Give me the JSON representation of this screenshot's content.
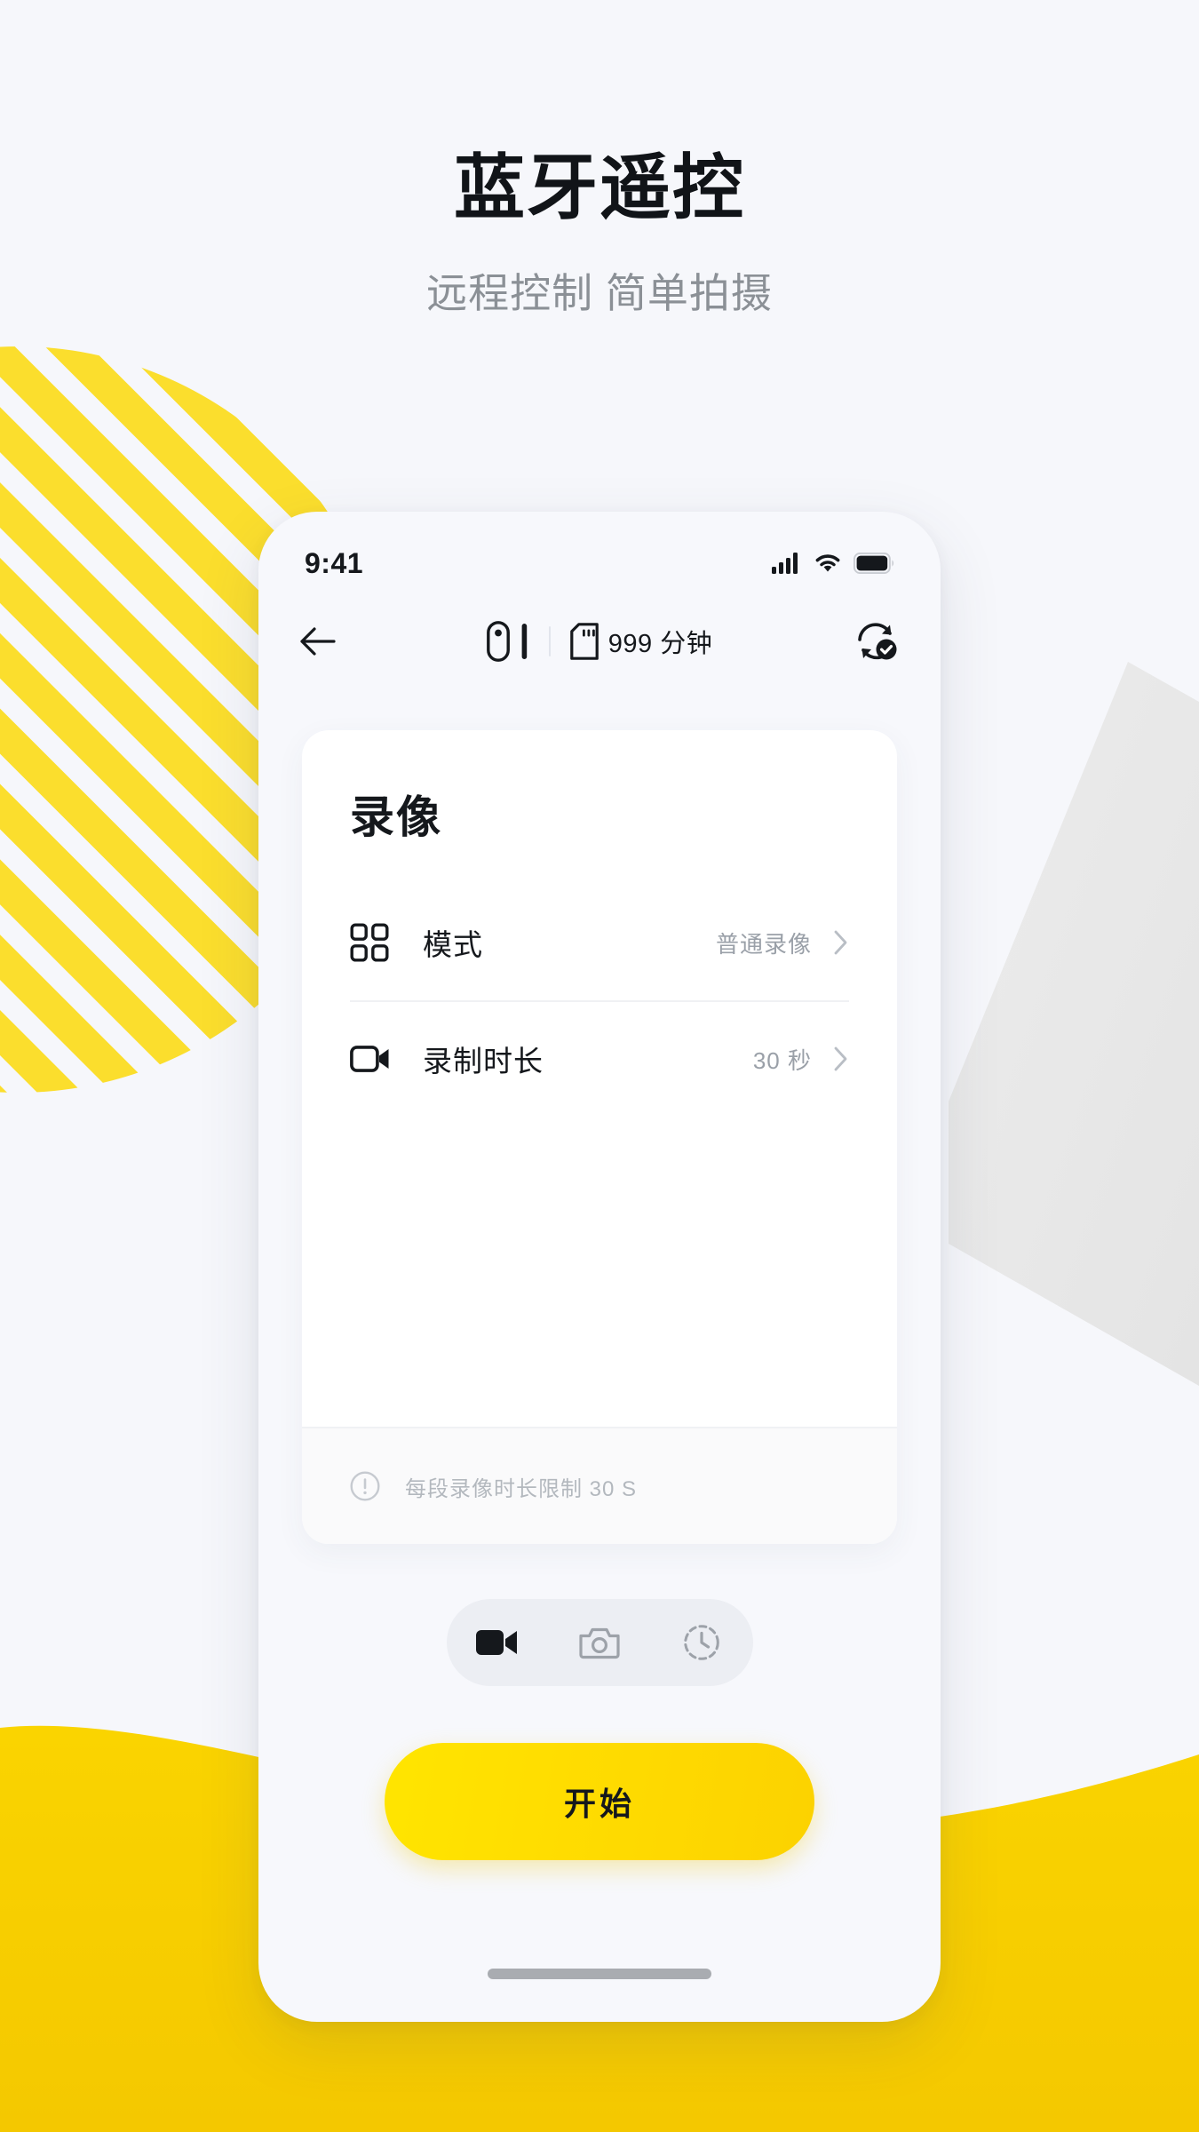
{
  "hero": {
    "title": "蓝牙遥控",
    "subtitle": "远程控制 简单拍摄"
  },
  "colors": {
    "page_bg": "#f6f7fb",
    "accent_yellow": "#fbd900",
    "stripe_yellow": "#fbde2d",
    "wave_yellow": "#f7cf00",
    "polygon_gray": "#e8e8e8",
    "text_dark": "#15181c",
    "text_muted": "#9aa0a8"
  },
  "phone": {
    "statusbar": {
      "time": "9:41",
      "icons": [
        "signal-icon",
        "wifi-icon",
        "battery-icon"
      ]
    },
    "navbar": {
      "back_icon": "arrow-left-icon",
      "device_icon": "camera-device-icon",
      "battery_bar_icon": "battery-bar-icon",
      "storage_icon": "sd-card-icon",
      "storage_text": "999 分钟",
      "sync_icon": "sync-check-icon"
    },
    "card": {
      "title": "录像",
      "rows": [
        {
          "icon": "grid-icon",
          "label": "模式",
          "value": "普通录像",
          "chevron": "chevron-right-icon"
        },
        {
          "icon": "video-camera-icon",
          "label": "录制时长",
          "value": "30 秒",
          "chevron": "chevron-right-icon"
        }
      ],
      "footnote": {
        "icon": "info-circle-icon",
        "text": "每段录像时长限制 30 S"
      }
    },
    "modebar": [
      {
        "icon": "video-record-icon",
        "active": true
      },
      {
        "icon": "photo-camera-icon",
        "active": false
      },
      {
        "icon": "timelapse-clock-icon",
        "active": false
      }
    ],
    "start_button": {
      "label": "开始"
    },
    "home_indicator": "home-indicator"
  }
}
